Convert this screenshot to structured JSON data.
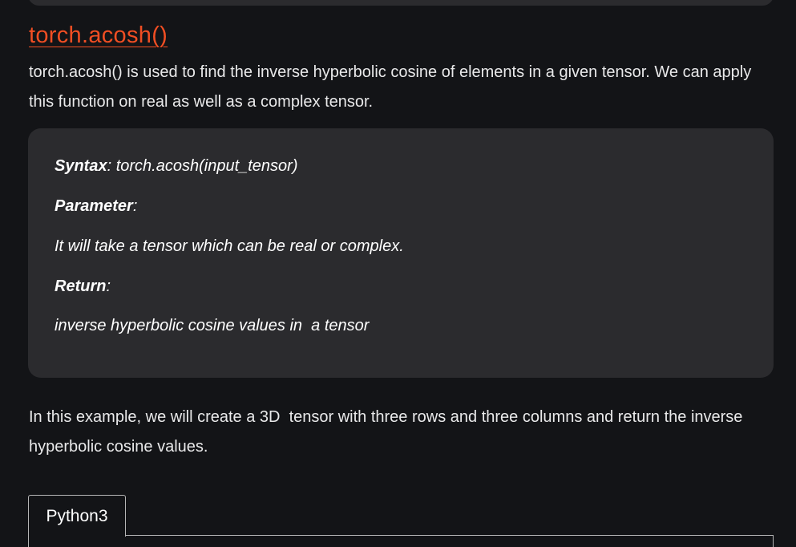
{
  "article": {
    "heading": "torch.acosh()",
    "intro": "torch.acosh() is used to find the inverse hyperbolic cosine of elements in a given tensor. We can apply this function on real as well as a complex tensor.",
    "syntax_box": {
      "syntax_label": "Syntax",
      "syntax_value": ": torch.acosh(input_tensor)",
      "parameter_label": "Parameter",
      "parameter_suffix": ":",
      "parameter_text": "It will take a tensor which can be real or complex.",
      "return_label": "Return",
      "return_suffix": ":",
      "return_text": "inverse hyperbolic cosine values in  a tensor"
    },
    "example_text": "In this example, we will create a 3D  tensor with three rows and three columns and return the inverse hyperbolic cosine values.",
    "code_tab_label": "Python3"
  },
  "colors": {
    "background": "#131417",
    "panel": "#2b2b2e",
    "heading_link": "#f04e23",
    "text": "#e9e9ea"
  }
}
